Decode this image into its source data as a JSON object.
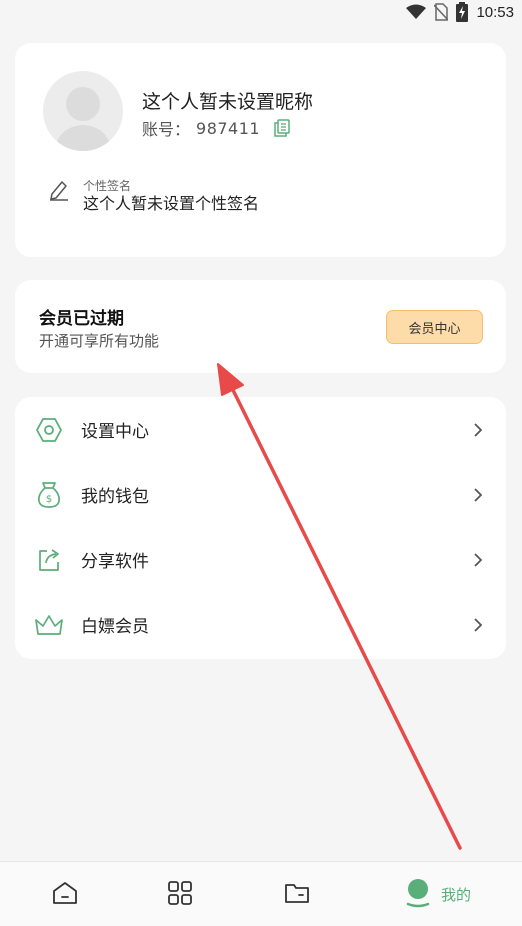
{
  "status_bar": {
    "time": "10:53"
  },
  "profile": {
    "nickname": "这个人暂未设置昵称",
    "account_label": "账号：",
    "account_value": "987411",
    "signature_label": "个性签名",
    "signature_value": "这个人暂未设置个性签名"
  },
  "vip": {
    "title": "会员已过期",
    "subtitle": "开通可享所有功能",
    "button_label": "会员中心"
  },
  "menu": {
    "items": [
      {
        "label": "设置中心",
        "icon": "settings-hexagon-icon"
      },
      {
        "label": "我的钱包",
        "icon": "money-bag-icon"
      },
      {
        "label": "分享软件",
        "icon": "share-icon"
      },
      {
        "label": "白嫖会员",
        "icon": "crown-icon"
      }
    ]
  },
  "bottom_nav": {
    "items": [
      {
        "icon": "home-icon",
        "label": ""
      },
      {
        "icon": "grid-icon",
        "label": ""
      },
      {
        "icon": "folder-icon",
        "label": ""
      },
      {
        "icon": "profile-icon",
        "label": "我的",
        "active": true
      }
    ]
  },
  "colors": {
    "accent_green": "#5aae7a",
    "vip_button_bg": "#fddcaa",
    "vip_button_border": "#f5bf6e",
    "annotation_red": "#e84a4a"
  }
}
